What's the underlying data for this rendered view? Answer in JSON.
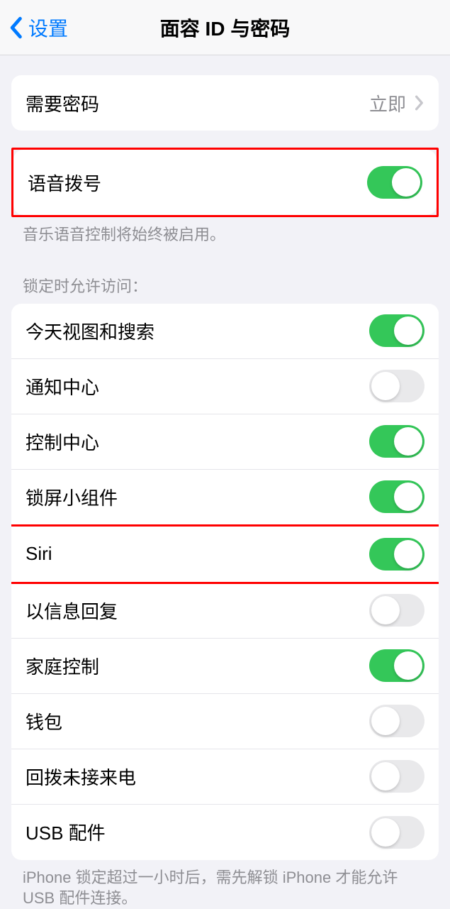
{
  "nav": {
    "back_label": "设置",
    "title": "面容 ID 与密码"
  },
  "require_passcode": {
    "label": "需要密码",
    "value": "立即"
  },
  "voice_dial": {
    "label": "语音拨号",
    "footer": "音乐语音控制将始终被启用。"
  },
  "lock_access": {
    "header": "锁定时允许访问：",
    "items": [
      {
        "label": "今天视图和搜索",
        "on": true
      },
      {
        "label": "通知中心",
        "on": false
      },
      {
        "label": "控制中心",
        "on": true
      },
      {
        "label": "锁屏小组件",
        "on": true
      },
      {
        "label": "Siri",
        "on": true
      },
      {
        "label": "以信息回复",
        "on": false
      },
      {
        "label": "家庭控制",
        "on": true
      },
      {
        "label": "钱包",
        "on": false
      },
      {
        "label": "回拨未接来电",
        "on": false
      },
      {
        "label": "USB 配件",
        "on": false
      }
    ],
    "footer": "iPhone 锁定超过一小时后，需先解锁 iPhone 才能允许 USB 配件连接。"
  }
}
